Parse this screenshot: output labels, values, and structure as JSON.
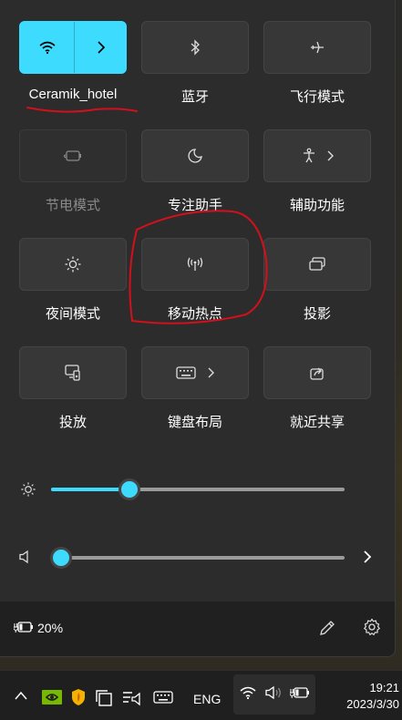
{
  "tiles": [
    {
      "label": "Ceramik_hotel",
      "icon": "wifi-icon",
      "state": "active",
      "has_chevron": true
    },
    {
      "label": "蓝牙",
      "icon": "bluetooth-icon",
      "state": "off"
    },
    {
      "label": "飞行模式",
      "icon": "airplane-icon",
      "state": "off"
    },
    {
      "label": "节电模式",
      "icon": "battery-saver-icon",
      "state": "disabled"
    },
    {
      "label": "专注助手",
      "icon": "moon-icon",
      "state": "off"
    },
    {
      "label": "辅助功能",
      "icon": "accessibility-icon",
      "state": "off",
      "has_chevron": true
    },
    {
      "label": "夜间模式",
      "icon": "brightness-icon",
      "state": "off"
    },
    {
      "label": "移动热点",
      "icon": "hotspot-icon",
      "state": "off"
    },
    {
      "label": "投影",
      "icon": "project-icon",
      "state": "off"
    },
    {
      "label": "投放",
      "icon": "cast-icon",
      "state": "off"
    },
    {
      "label": "键盘布局",
      "icon": "keyboard-icon",
      "state": "off",
      "has_chevron": true
    },
    {
      "label": "就近共享",
      "icon": "share-icon",
      "state": "off"
    }
  ],
  "brightness": {
    "value": 0.25
  },
  "volume": {
    "value": 0.0
  },
  "battery": {
    "percent": "20%"
  },
  "taskbar": {
    "language": "ENG",
    "time": "19:21",
    "date": "2023/3/30"
  },
  "colors": {
    "accent": "#3ddcff",
    "annotation": "#d4101c"
  }
}
